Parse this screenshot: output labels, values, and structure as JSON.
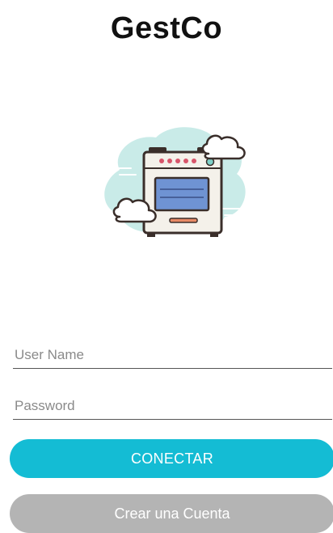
{
  "app": {
    "title": "GestCo"
  },
  "login": {
    "username_placeholder": "User Name",
    "password_placeholder": "Password",
    "connect_label": "CONECTAR",
    "create_account_label": "Crear una Cuenta"
  },
  "illustration": {
    "icon": "oven-with-clouds-icon"
  },
  "colors": {
    "primary": "#14bcd4",
    "secondary": "#b4b4b4",
    "cloud": "#c9ebe8",
    "oven_window": "#6f93d3"
  }
}
